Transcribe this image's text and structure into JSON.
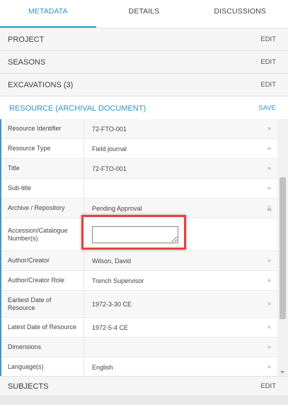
{
  "tabs": [
    {
      "label": "METADATA"
    },
    {
      "label": "DETAILS"
    },
    {
      "label": "DISCUSSIONS"
    }
  ],
  "sections": {
    "project": {
      "title": "PROJECT",
      "action": "EDIT"
    },
    "seasons": {
      "title": "SEASONS",
      "action": "EDIT"
    },
    "excavations": {
      "title": "EXCAVATIONS (3)",
      "action": "EDIT"
    },
    "resource": {
      "title": "RESOURCE (ARCHIVAL DOCUMENT)",
      "action": "SAVE"
    },
    "subjects": {
      "title": "SUBJECTS",
      "action": "EDIT"
    }
  },
  "fields": [
    {
      "label": "Resource Identifier",
      "value": "72-FTO-001"
    },
    {
      "label": "Resource Type",
      "value": "Field journal"
    },
    {
      "label": "Title",
      "value": "72-FTO-001"
    },
    {
      "label": "Sub-title",
      "value": ""
    },
    {
      "label": "Archive / Repository",
      "value": "Pending Approval"
    },
    {
      "label": "Accession/Catalogue Number(s)",
      "value": ""
    },
    {
      "label": "Author/Creator",
      "value": "Wilson, David"
    },
    {
      "label": "Author/Creator Role",
      "value": "Trench Supervisor"
    },
    {
      "label": "Earliest Date of Resource",
      "value": "1972-3-30 CE"
    },
    {
      "label": "Latest Date of Resource",
      "value": "1972-5-4 CE"
    },
    {
      "label": "Dimensions",
      "value": ""
    },
    {
      "label": "Language(s)",
      "value": "English"
    }
  ],
  "colors": {
    "accent": "#2f95c9",
    "highlight": "#e54141"
  }
}
